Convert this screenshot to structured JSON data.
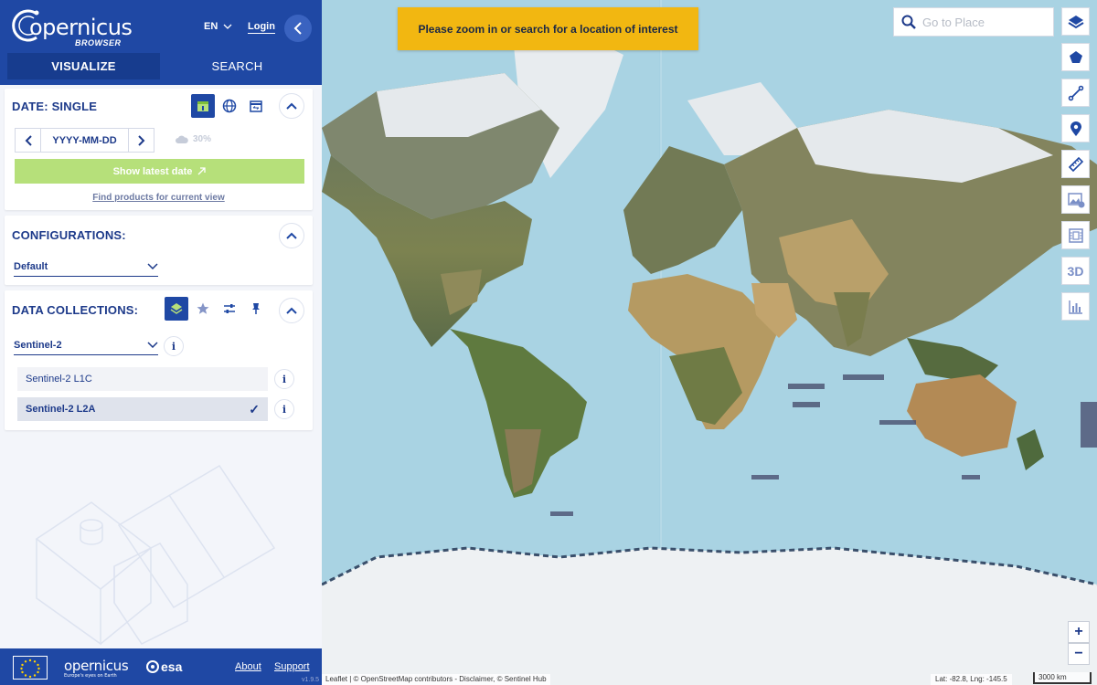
{
  "header": {
    "brand": "opernicus",
    "brand_sub": "BROWSER",
    "language": "EN",
    "login_label": "Login"
  },
  "tabs": [
    {
      "label": "VISUALIZE",
      "active": true
    },
    {
      "label": "SEARCH",
      "active": false
    }
  ],
  "date_panel": {
    "title": "DATE: SINGLE",
    "date_value": "YYYY-MM-DD",
    "cloud_coverage": "30%",
    "show_latest_label": "Show latest date",
    "find_products_label": "Find products for current view"
  },
  "configurations_panel": {
    "title": "CONFIGURATIONS:",
    "selected": "Default"
  },
  "collections_panel": {
    "title": "DATA COLLECTIONS:",
    "selected_collection": "Sentinel-2",
    "info_glyph": "i",
    "items": [
      {
        "label": "Sentinel-2 L1C",
        "selected": false
      },
      {
        "label": "Sentinel-2 L2A",
        "selected": true
      }
    ],
    "check_glyph": "✓"
  },
  "footer": {
    "brand": "opernicus",
    "brand_tagline": "Europe's eyes on Earth",
    "esa": "esa",
    "about_label": "About",
    "support_label": "Support",
    "version": "v1.9.5"
  },
  "map": {
    "notice": "Please zoom in or search for a location of interest",
    "search_placeholder": "Go to Place",
    "tools": [
      "layers-icon",
      "polygon-icon",
      "line-icon",
      "pin-icon",
      "ruler-icon",
      "image-download-icon",
      "timelapse-icon",
      "3d-icon",
      "histogram-icon"
    ],
    "tool_3d_label": "3D",
    "zoom_in": "+",
    "zoom_out": "−",
    "attribution": "Leaflet | © OpenStreetMap contributors - Disclaimer, © Sentinel Hub",
    "coordinates": "Lat: -82.8, Lng: -145.5",
    "scale": "3000 km"
  },
  "colors": {
    "brand_blue": "#1f48a4",
    "ocean": "#a9d3e3",
    "notice": "#f2b711",
    "latest_button": "#b6e07a"
  }
}
